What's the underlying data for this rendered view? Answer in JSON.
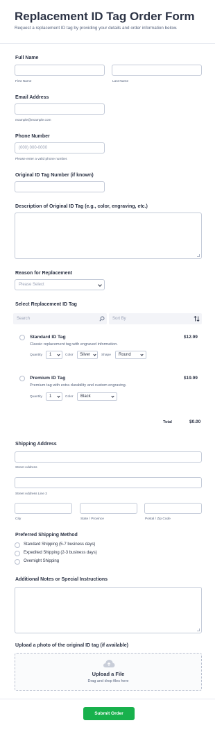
{
  "header": {
    "title": "Replacement ID Tag Order Form",
    "subtitle": "Request a replacement ID tag by providing your details and order information below."
  },
  "full_name": {
    "label": "Full Name",
    "first_sub": "First Name",
    "last_sub": "Last Name"
  },
  "email": {
    "label": "Email Address",
    "sub": "example@example.com"
  },
  "phone": {
    "label": "Phone Number",
    "placeholder": "(000) 000-0000",
    "sub": "Please enter a valid phone number."
  },
  "original_tag": {
    "label": "Original ID Tag Number (if known)"
  },
  "description": {
    "label": "Description of Original ID Tag (e.g., color, engraving, etc.)"
  },
  "reason": {
    "label": "Reason for Replacement",
    "placeholder": "Please Select"
  },
  "products": {
    "label": "Select Replacement ID Tag",
    "search_placeholder": "Search",
    "sort_placeholder": "Sort By",
    "items": [
      {
        "name": "Standard ID Tag",
        "desc": "Classic replacement tag with engraved information.",
        "price": "$12.99",
        "quantity_label": "Quantity",
        "quantity": "1",
        "color_label": "Color",
        "color": "Silver",
        "shape_label": "Shape",
        "shape": "Round"
      },
      {
        "name": "Premium ID Tag",
        "desc": "Premium tag with extra durability and custom engraving.",
        "price": "$19.99",
        "quantity_label": "Quantity",
        "quantity": "1",
        "color_label": "Color",
        "color": "Black"
      }
    ],
    "total_label": "Total",
    "total_value": "$0.00"
  },
  "shipping": {
    "label": "Shipping Address",
    "street_sub": "Street Address",
    "street2_sub": "Street Address Line 2",
    "city_sub": "City",
    "state_sub": "State / Province",
    "postal_sub": "Postal / Zip Code"
  },
  "method": {
    "label": "Preferred Shipping Method",
    "options": [
      "Standard Shipping (5-7 business days)",
      "Expedited Shipping (2-3 business days)",
      "Overnight Shipping"
    ]
  },
  "notes": {
    "label": "Additional Notes or Special Instructions"
  },
  "upload": {
    "label": "Upload a photo of the original ID tag (if available)",
    "title": "Upload a File",
    "sub": "Drag and drop files here"
  },
  "submit": {
    "label": "Submit Order"
  },
  "colors": {
    "accent": "#18b14c",
    "text": "#2c3345",
    "muted": "#57647e",
    "border": "#c3cad8"
  },
  "icons": [
    "search-icon",
    "sort-icon",
    "chevron-down-icon",
    "cloud-upload-icon"
  ]
}
